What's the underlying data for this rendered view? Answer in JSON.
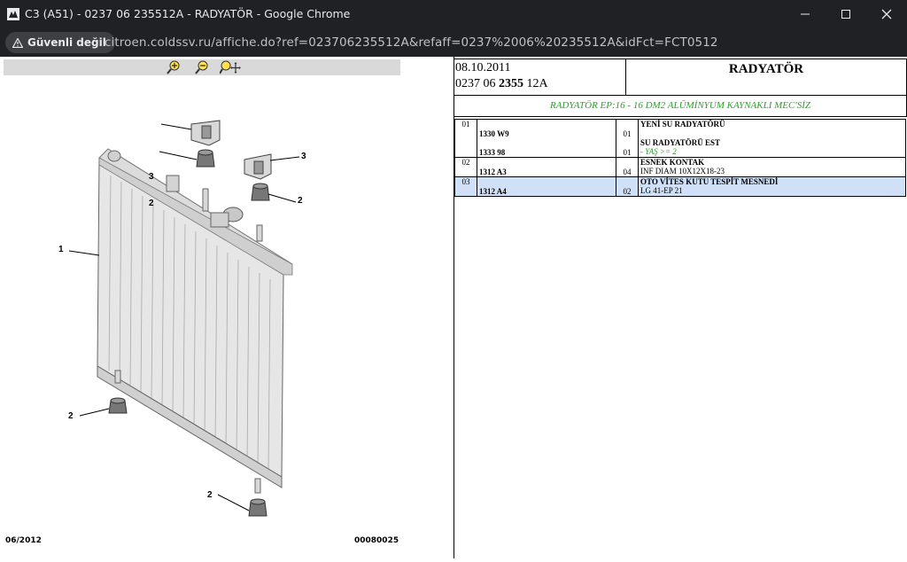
{
  "window": {
    "title": "C3 (A51) - 0237 06 235512A - RADYATÖR - Google Chrome"
  },
  "address_bar": {
    "security_label": "Güvenli değil",
    "url": "citroen.coldssv.ru/affiche.do?ref=023706235512A&refaff=0237%2006%20235512A&idFct=FCT0512"
  },
  "diagram": {
    "callouts": [
      "1",
      "2",
      "3"
    ],
    "footer_date": "06/2012",
    "footer_code": "00080025"
  },
  "header": {
    "date": "08.10.2011",
    "ref_prefix": "0237 06 ",
    "ref_bold": "2355",
    "ref_suffix": " 12A",
    "title": "RADYATÖR"
  },
  "subtitle": "RADYATÖR EP:16 - 16 DM2 ALÜMİNYUM KAYNAKLI MEC'SİZ",
  "parts": [
    {
      "index": "01",
      "refs": [
        "",
        "1330 W9",
        "",
        "1333 98"
      ],
      "qtys": [
        "",
        "01",
        "",
        "01"
      ],
      "lines": [
        "YENİ SU RADYATÖRÜ",
        "",
        "SU RADYATÖRÜ EST",
        "- YAŞ >= 2"
      ]
    },
    {
      "index": "02",
      "refs": [
        "",
        "1312 A3"
      ],
      "qtys": [
        "",
        "04"
      ],
      "lines": [
        "ESNEK KONTAK",
        "INF DIAM 10X12X18-23"
      ]
    },
    {
      "index": "03",
      "refs": [
        "",
        "1312 A4"
      ],
      "qtys": [
        "",
        "02"
      ],
      "lines": [
        "OTO VİTES KUTU TESPİT MESNEDİ",
        "LG 41-EP 21"
      ]
    }
  ]
}
